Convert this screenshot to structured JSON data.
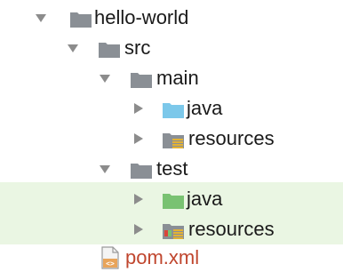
{
  "tree": {
    "root": {
      "label": "hello-world",
      "icon": "folder-icon",
      "expanded": true
    },
    "src": {
      "label": "src",
      "icon": "folder-icon",
      "expanded": true
    },
    "main": {
      "label": "main",
      "icon": "folder-icon",
      "expanded": true
    },
    "main_java": {
      "label": "java",
      "icon": "source-folder-icon",
      "expanded": false
    },
    "main_resources": {
      "label": "resources",
      "icon": "resources-folder-icon",
      "expanded": false
    },
    "test": {
      "label": "test",
      "icon": "folder-icon",
      "expanded": true
    },
    "test_java": {
      "label": "java",
      "icon": "test-source-folder-icon",
      "expanded": false
    },
    "test_resources": {
      "label": "resources",
      "icon": "test-resources-folder-icon",
      "expanded": false
    },
    "pom": {
      "label": "pom.xml",
      "icon": "maven-file-icon"
    }
  },
  "colors": {
    "folder_gray": "#8a8f95",
    "source_blue": "#7cc8ea",
    "test_green": "#79c272",
    "highlight_bg": "#eaf6e3",
    "pom_text": "#c0462e",
    "arrow_gray": "#8c8c8c"
  }
}
